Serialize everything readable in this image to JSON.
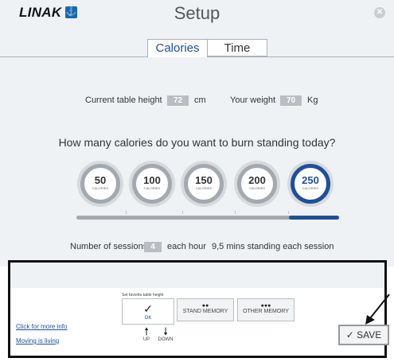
{
  "header": {
    "logo": "LINAK",
    "title": "Setup",
    "close_glyph": "✕"
  },
  "tabs": [
    {
      "label": "Calories",
      "active": true
    },
    {
      "label": "Time",
      "active": false
    }
  ],
  "info": {
    "height_label": "Current table height",
    "height_value": "72",
    "height_unit": "cm",
    "weight_label": "Your weight",
    "weight_value": "70",
    "weight_unit": "Kg"
  },
  "question": "How many calories do you want to burn standing today?",
  "calorie_options": [
    {
      "value": "50",
      "unit": "CALORIES"
    },
    {
      "value": "100",
      "unit": "CALORIES"
    },
    {
      "value": "150",
      "unit": "CALORIES"
    },
    {
      "value": "200",
      "unit": "CALORIES"
    },
    {
      "value": "250",
      "unit": "CALORIES"
    }
  ],
  "selected_calories": "250",
  "sessions": {
    "prefix": "Number of sessions",
    "count": "4",
    "suffix": "each hour",
    "detail": "9,5 mins standing each session"
  },
  "bottom": {
    "favorite_label": "Set favorite table height",
    "ok_label": "OK",
    "stand_memory": "STAND MEMORY",
    "other_memory": "OTHER MEMORY",
    "up_label": "UP",
    "down_label": "DOWN",
    "link_info": "Click for more info",
    "link_moving": "Moving is living",
    "save_label": "SAVE"
  },
  "colors": {
    "accent": "#1f4f9c",
    "brand_icon": "#1a65b8",
    "background": "#eef2f5"
  }
}
